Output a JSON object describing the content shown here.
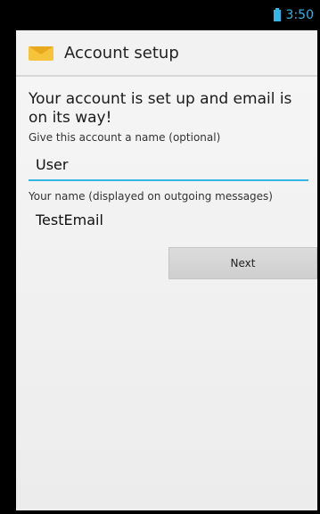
{
  "status_bar": {
    "time": "3:50",
    "battery_icon": "battery-icon"
  },
  "action_bar": {
    "title": "Account setup",
    "icon": "email-app-icon"
  },
  "main": {
    "headline": "Your account is set up and email is on its way!",
    "account_name_label": "Give this account a name (optional)",
    "account_name_value": "User",
    "your_name_label": "Your name (displayed on outgoing messages)",
    "your_name_value": "TestEmail",
    "next_label": "Next"
  },
  "colors": {
    "accent": "#33b5e5",
    "app_icon": "#f6c43a"
  }
}
